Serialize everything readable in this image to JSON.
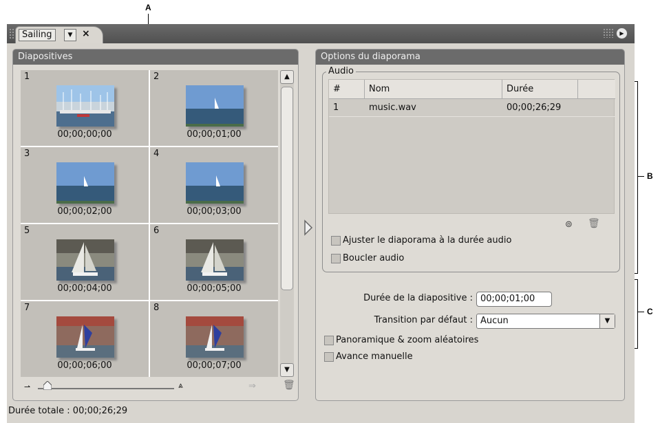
{
  "callouts": {
    "a": "A",
    "b": "B",
    "c": "C"
  },
  "tab": {
    "title": "Sailing",
    "dropdown": "▼",
    "close": "×",
    "menu": "▶"
  },
  "slides_panel": {
    "title": "Diapositives",
    "slides": [
      {
        "number": "1",
        "time": "00;00;00;00",
        "scene": "harbor"
      },
      {
        "number": "2",
        "time": "00;00;01;00",
        "scene": "sea"
      },
      {
        "number": "3",
        "time": "00;00;02;00",
        "scene": "sea"
      },
      {
        "number": "4",
        "time": "00;00;03;00",
        "scene": "sea"
      },
      {
        "number": "5",
        "time": "00;00;04;00",
        "scene": "sail-white"
      },
      {
        "number": "6",
        "time": "00;00;05;00",
        "scene": "sail-white"
      },
      {
        "number": "7",
        "time": "00;00;06;00",
        "scene": "sail-blue"
      },
      {
        "number": "8",
        "time": "00;00;07;00",
        "scene": "sail-blue"
      }
    ],
    "scroll_up": "▲",
    "scroll_down": "▼",
    "zoom_small_icon": "⇀",
    "zoom_large_icon": "⩓",
    "create_sequence_icon": "⇒",
    "trash_icon": "🗑"
  },
  "footer": {
    "total_duration": "Durée totale : 00;00;26;29"
  },
  "options_panel": {
    "title": "Options du diaporama",
    "audio": {
      "legend": "Audio",
      "columns": [
        "#",
        "Nom",
        "Durée"
      ],
      "rows": [
        {
          "index": "1",
          "name": "music.wav",
          "duration": "00;00;26;29"
        }
      ],
      "link_icon": "⊚",
      "trash_icon": "🗑"
    },
    "fit_to_audio": {
      "label": "Ajuster le diaporama à la durée audio",
      "checked": false
    },
    "loop_audio": {
      "label": "Boucler audio",
      "checked": false
    },
    "slide_duration": {
      "label": "Durée de la diapositive :",
      "value": "00;00;01;00"
    },
    "default_transition": {
      "label": "Transition par défaut :",
      "value": "Aucun",
      "arrow": "▼"
    },
    "random_pan_zoom": {
      "label": "Panoramique & zoom aléatoires",
      "checked": false
    },
    "manual_advance": {
      "label": "Avance manuelle",
      "checked": false
    }
  }
}
